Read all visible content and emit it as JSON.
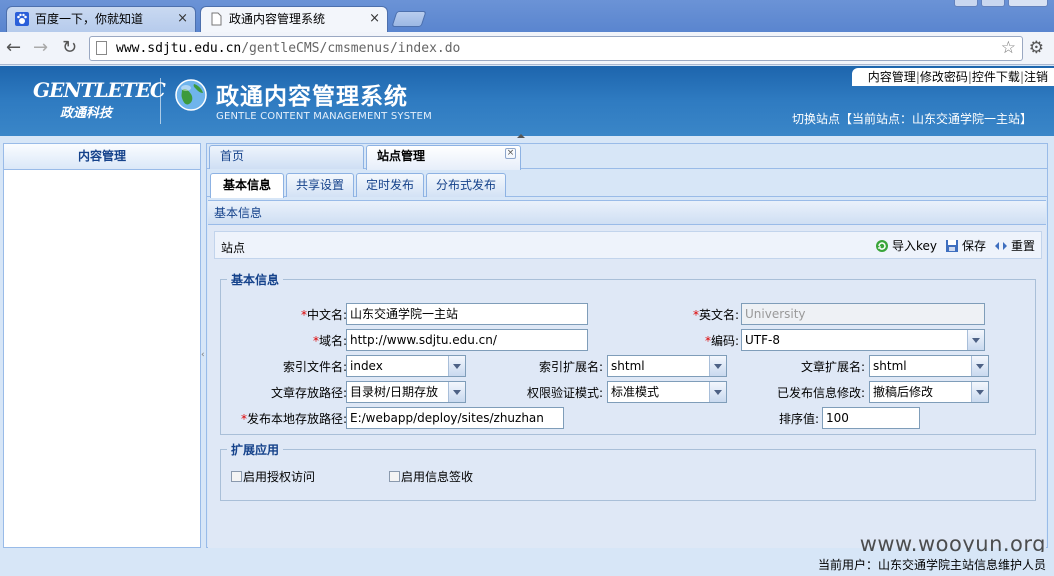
{
  "browser": {
    "tabs": [
      {
        "title": "百度一下，你就知道",
        "icon": "baidu-paw-icon"
      },
      {
        "title": "政通内容管理系统",
        "icon": "page-icon"
      }
    ],
    "url_host": "www.sdjtu.edu.cn",
    "url_path": "/gentleCMS/cmsmenus/index.do"
  },
  "header": {
    "logo_en": "GENTLETEC",
    "logo_cn": "政通科技",
    "title": "政通内容管理系统",
    "subtitle": "GENTLE CONTENT MANAGEMENT SYSTEM",
    "links": [
      "内容管理",
      "修改密码",
      "控件下载",
      "注销"
    ],
    "site_switch": "切换站点【当前站点：山东交通学院一主站】"
  },
  "left": {
    "title": "内容管理"
  },
  "main_tabs": [
    "首页",
    "站点管理"
  ],
  "sub_tabs": [
    "基本信息",
    "共享设置",
    "定时发布",
    "分布式发布"
  ],
  "panel": {
    "title": "基本信息",
    "bar_label": "站点",
    "actions": [
      "导入key",
      "保存",
      "重置"
    ]
  },
  "basic": {
    "legend": "基本信息",
    "cn_name": {
      "label": "中文名:",
      "value": "山东交通学院一主站"
    },
    "en_name": {
      "label": "英文名:",
      "value": "University"
    },
    "domain": {
      "label": "域名:",
      "value": "http://www.sdjtu.edu.cn/"
    },
    "encoding": {
      "label": "编码:",
      "value": "UTF-8"
    },
    "index_file": {
      "label": "索引文件名:",
      "value": "index"
    },
    "index_ext": {
      "label": "索引扩展名:",
      "value": "shtml"
    },
    "article_ext": {
      "label": "文章扩展名:",
      "value": "shtml"
    },
    "store_path": {
      "label": "文章存放路径:",
      "value": "目录树/日期存放"
    },
    "auth_mode": {
      "label": "权限验证模式:",
      "value": "标准模式"
    },
    "published_edit": {
      "label": "已发布信息修改:",
      "value": "撤稿后修改"
    },
    "publish_path": {
      "label": "发布本地存放路径:",
      "value": "E:/webapp/deploy/sites/zhuzhan"
    },
    "sort": {
      "label": "排序值:",
      "value": "100"
    }
  },
  "ext": {
    "legend": "扩展应用",
    "options": [
      "启用授权访问",
      "启用信息签收"
    ]
  },
  "footer": {
    "user": "当前用户：山东交通学院主站信息维护人员"
  },
  "watermark": "www.wooyun.org",
  "colors": {
    "header_blue": "#2f7bc1",
    "panel_bg": "#dfe8f6",
    "required": "#dd0000"
  }
}
